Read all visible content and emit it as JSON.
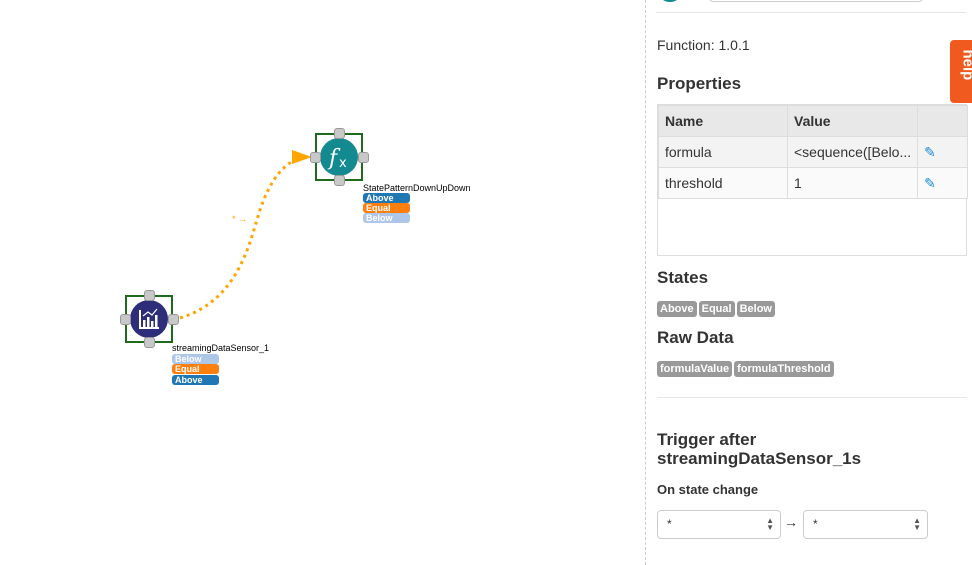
{
  "nodes": {
    "sensor": {
      "label": "streamingDataSensor_1",
      "states": [
        "Below",
        "Equal",
        "Above"
      ]
    },
    "function": {
      "label": "StatePatternDownUpDown",
      "states": [
        "Above",
        "Equal",
        "Below"
      ]
    }
  },
  "panel": {
    "version": "Function: 1.0.1",
    "properties_title": "Properties",
    "columns": [
      "Name",
      "Value"
    ],
    "rows": [
      {
        "name": "formula",
        "value": "<sequence([Belo..."
      },
      {
        "name": "threshold",
        "value": "1"
      }
    ],
    "states_title": "States",
    "states": [
      "Above",
      "Equal",
      "Below"
    ],
    "raw_title": "Raw Data",
    "raw": [
      "formulaValue",
      "formulaThreshold"
    ],
    "trigger_title": "Trigger after streamingDataSensor_1s",
    "state_change_label": "On state change",
    "from_value": "*",
    "to_value": "*",
    "arrow": "→"
  },
  "help": "help",
  "colors": {
    "above": "#1f77b4",
    "equal": "#ff7f0e",
    "below": "#aec7e8",
    "edge": "#ffa500"
  }
}
